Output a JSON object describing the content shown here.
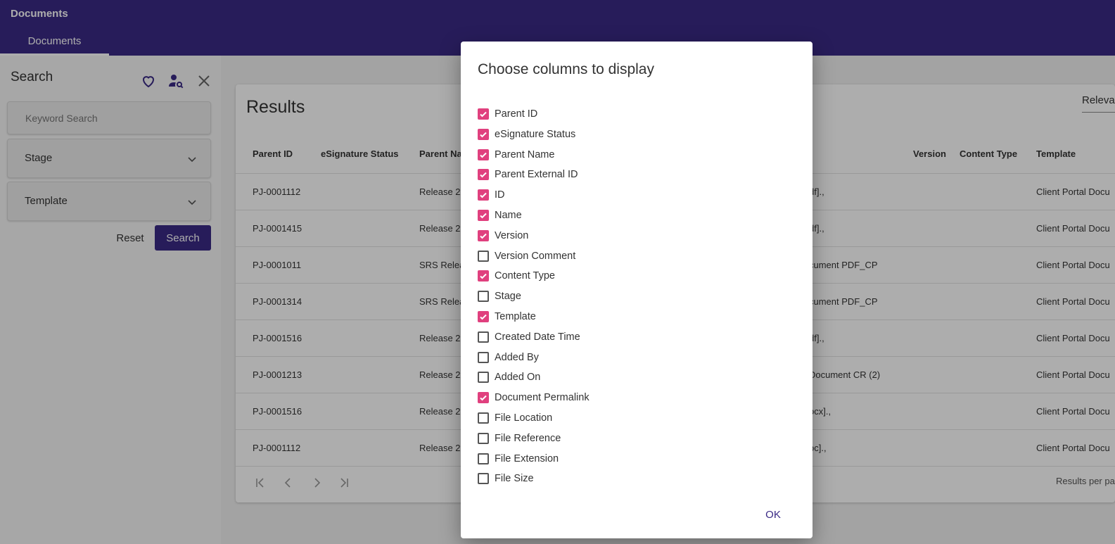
{
  "app": {
    "title": "Documents",
    "tab": "Documents"
  },
  "sidebar": {
    "title": "Search",
    "keyword_placeholder": "Keyword Search",
    "stage_label": "Stage",
    "template_label": "Template",
    "reset_label": "Reset",
    "search_label": "Search",
    "icons": [
      "heart-icon",
      "person-search-icon",
      "close-icon"
    ]
  },
  "results": {
    "title": "Results",
    "sort_label": "Relevance",
    "columns": [
      "Parent ID",
      "eSignature Status",
      "Parent Na",
      "Version",
      "Content Type",
      "Template"
    ],
    "rows": [
      {
        "parent_id": "PJ-0001112",
        "parent_name": "Release 2",
        "file": "df].,",
        "template": "Client Portal Docu"
      },
      {
        "parent_id": "PJ-0001415",
        "parent_name": "Release 2",
        "file": "df].,",
        "template": "Client Portal Docu"
      },
      {
        "parent_id": "PJ-0001011",
        "parent_name": "SRS Relea",
        "file": "cument PDF_CP",
        "template": "Client Portal Docu"
      },
      {
        "parent_id": "PJ-0001314",
        "parent_name": "SRS Relea",
        "file": "cument PDF_CP",
        "template": "Client Portal Docu"
      },
      {
        "parent_id": "PJ-0001516",
        "parent_name": "Release 2",
        "file": "df].,",
        "template": "Client Portal Docu"
      },
      {
        "parent_id": "PJ-0001213",
        "parent_name": "Release 2",
        "file": "Document CR (2)",
        "template": "Client Portal Docu"
      },
      {
        "parent_id": "PJ-0001516",
        "parent_name": "Release 2",
        "file": "ocx].,",
        "template": "Client Portal Docu"
      },
      {
        "parent_id": "PJ-0001112",
        "parent_name": "Release 2",
        "file": "oc].,",
        "template": "Client Portal Docu"
      }
    ],
    "results_per_page_label": "Results per pa"
  },
  "dialog": {
    "title": "Choose columns to display",
    "options": [
      {
        "label": "Parent ID",
        "checked": true
      },
      {
        "label": "eSignature Status",
        "checked": true
      },
      {
        "label": "Parent Name",
        "checked": true
      },
      {
        "label": "Parent External ID",
        "checked": true
      },
      {
        "label": "ID",
        "checked": true
      },
      {
        "label": "Name",
        "checked": true
      },
      {
        "label": "Version",
        "checked": true
      },
      {
        "label": "Version Comment",
        "checked": false
      },
      {
        "label": "Content Type",
        "checked": true
      },
      {
        "label": "Stage",
        "checked": false
      },
      {
        "label": "Template",
        "checked": true
      },
      {
        "label": "Created Date Time",
        "checked": false
      },
      {
        "label": "Added By",
        "checked": false
      },
      {
        "label": "Added On",
        "checked": false
      },
      {
        "label": "Document Permalink",
        "checked": true
      },
      {
        "label": "File Location",
        "checked": false
      },
      {
        "label": "File Reference",
        "checked": false
      },
      {
        "label": "File Extension",
        "checked": false
      },
      {
        "label": "File Size",
        "checked": false
      }
    ],
    "ok_label": "OK"
  },
  "colors": {
    "brand": "#3a2a85",
    "checkbox_on": "#e0407e"
  }
}
